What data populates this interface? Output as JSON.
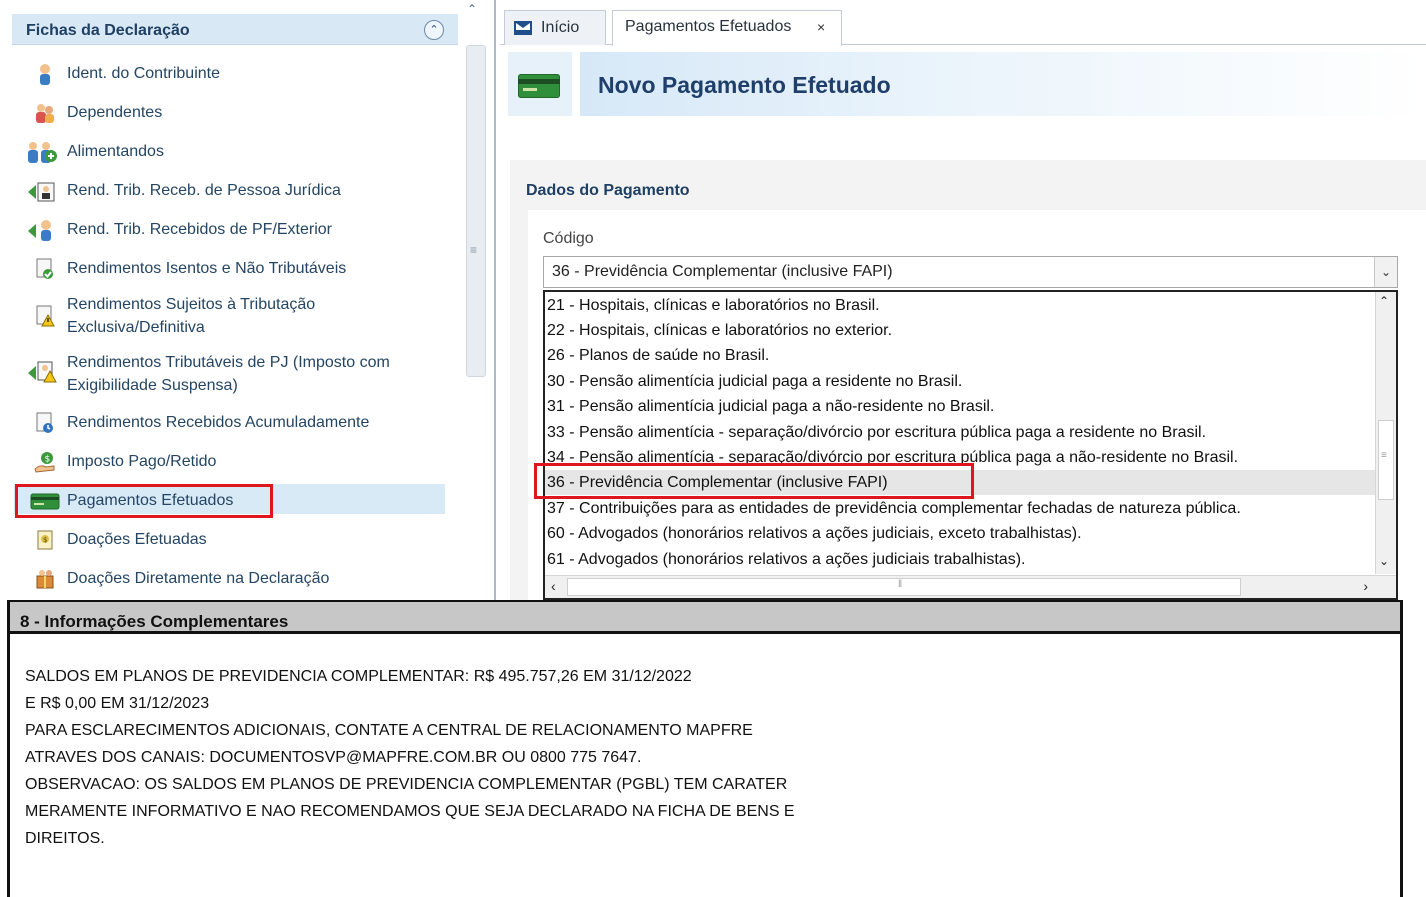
{
  "sidebar": {
    "title": "Fichas da Declaração",
    "items": [
      {
        "label": "Ident. do Contribuinte",
        "icon": "person-icon"
      },
      {
        "label": "Dependentes",
        "icon": "family-icon"
      },
      {
        "label": "Alimentandos",
        "icon": "add-person-icon"
      },
      {
        "label": "Rend. Trib. Receb. de Pessoa Jurídica",
        "icon": "income-company-icon"
      },
      {
        "label": "Rend. Trib. Recebidos de PF/Exterior",
        "icon": "income-person-icon"
      },
      {
        "label": "Rendimentos Isentos e Não Tributáveis",
        "icon": "document-check-icon"
      },
      {
        "label": "Rendimentos Sujeitos à Tributação",
        "label2": "Exclusiva/Definitiva",
        "icon": "warning-document-icon"
      },
      {
        "label": "Rendimentos Tributáveis de PJ (Imposto com",
        "label2": "Exigibilidade Suspensa)",
        "icon": "suspended-income-icon"
      },
      {
        "label": "Rendimentos Recebidos Acumuladamente",
        "icon": "document-clock-icon"
      },
      {
        "label": "Imposto Pago/Retido",
        "icon": "money-hand-icon"
      },
      {
        "label": "Pagamentos Efetuados",
        "icon": "credit-card-icon",
        "selected": true
      },
      {
        "label": "Doações Efetuadas",
        "icon": "donation-icon"
      },
      {
        "label": "Doações Diretamente na Declaração",
        "icon": "gift-icon"
      }
    ]
  },
  "tabs": {
    "inicio": "Início",
    "pagamentos": "Pagamentos Efetuados",
    "close": "×"
  },
  "page": {
    "title": "Novo Pagamento Efetuado"
  },
  "form": {
    "section_title": "Dados do Pagamento",
    "codigo_label": "Código",
    "codigo_value": "36 - Previdência Complementar (inclusive FAPI)",
    "options": [
      "21 - Hospitais, clínicas e laboratórios no Brasil.",
      "22 - Hospitais, clínicas e laboratórios no exterior.",
      "26 - Planos de saúde no Brasil.",
      "30 - Pensão alimentícia judicial paga a residente no Brasil.",
      "31 - Pensão alimentícia judicial paga a não-residente no Brasil.",
      "33 - Pensão alimentícia - separação/divórcio por escritura pública paga a residente no Brasil.",
      "34 - Pensão alimentícia - separação/divórcio por escritura pública paga a não-residente no Brasil.",
      "36 - Previdência Complementar (inclusive FAPI)",
      "37 - Contribuições para as entidades de previdência complementar fechadas de natureza pública.",
      "60 - Advogados (honorários relativos a ações judiciais, exceto trabalhistas).",
      "61 - Advogados (honorários relativos a ações judiciais trabalhistas)."
    ],
    "selected_index": 7
  },
  "info": {
    "title": "8 - Informações Complementares",
    "lines": [
      "SALDOS EM PLANOS DE PREVIDENCIA COMPLEMENTAR: R$ 495.757,26 EM 31/12/2022",
      "E R$ 0,00 EM 31/12/2023",
      "PARA ESCLARECIMENTOS ADICIONAIS, CONTATE A CENTRAL DE RELACIONAMENTO MAPFRE",
      "ATRAVES DOS CANAIS: DOCUMENTOSVP@MAPFRE.COM.BR OU 0800 775 7647.",
      "OBSERVACAO: OS SALDOS EM PLANOS DE PREVIDENCIA COMPLEMENTAR (PGBL) TEM CARATER",
      "MERAMENTE INFORMATIVO E NAO RECOMENDAMOS QUE SEJA DECLARADO NA FICHA DE BENS E",
      "DIREITOS."
    ]
  },
  "colors": {
    "highlight_red": "#e0161f",
    "header_blue": "#1f3f63",
    "selected_bg": "#d9eaf7",
    "card_green": "#2f8f3b"
  }
}
